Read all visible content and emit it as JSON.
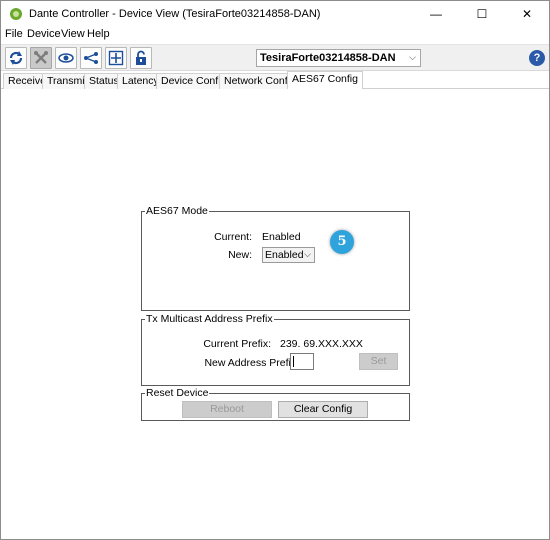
{
  "window": {
    "title": "Dante Controller - Device View (TesiraForte03214858-DAN)",
    "minimize_glyph": "—",
    "maximize_glyph": "☐",
    "close_glyph": "✕"
  },
  "menu": [
    "File",
    "Device",
    "View",
    "Help"
  ],
  "toolbar": {
    "icons": [
      "refresh-icon",
      "tools-icon",
      "eye-icon",
      "network-icon",
      "add-icon",
      "lock-icon"
    ],
    "device": "TesiraForte03214858-DAN",
    "dropdown_glyph": "⌵",
    "help_glyph": "?"
  },
  "tabs": [
    "Receive",
    "Transmit",
    "Status",
    "Latency",
    "Device Config",
    "Network Config",
    "AES67 Config"
  ],
  "selected_tab": "AES67 Config",
  "aes67_mode": {
    "title": "AES67 Mode",
    "current_label": "Current:",
    "current_value": "Enabled",
    "new_label": "New:",
    "new_value": "Enabled",
    "dropdown_glyph": "⌵"
  },
  "tx_prefix": {
    "title": "Tx Multicast Address Prefix",
    "current_label": "Current Prefix:",
    "current_value": "239. 69.XXX.XXX",
    "new_label": "New Address Prefix:",
    "new_value": "",
    "set_label": "Set"
  },
  "reset": {
    "title": "Reset Device",
    "reboot_label": "Reboot",
    "clear_label": "Clear Config"
  },
  "callout": "5",
  "colors": {
    "callout": "#2ea3dc",
    "help": "#2b5aa8",
    "app_icon": "#6aa82e"
  }
}
